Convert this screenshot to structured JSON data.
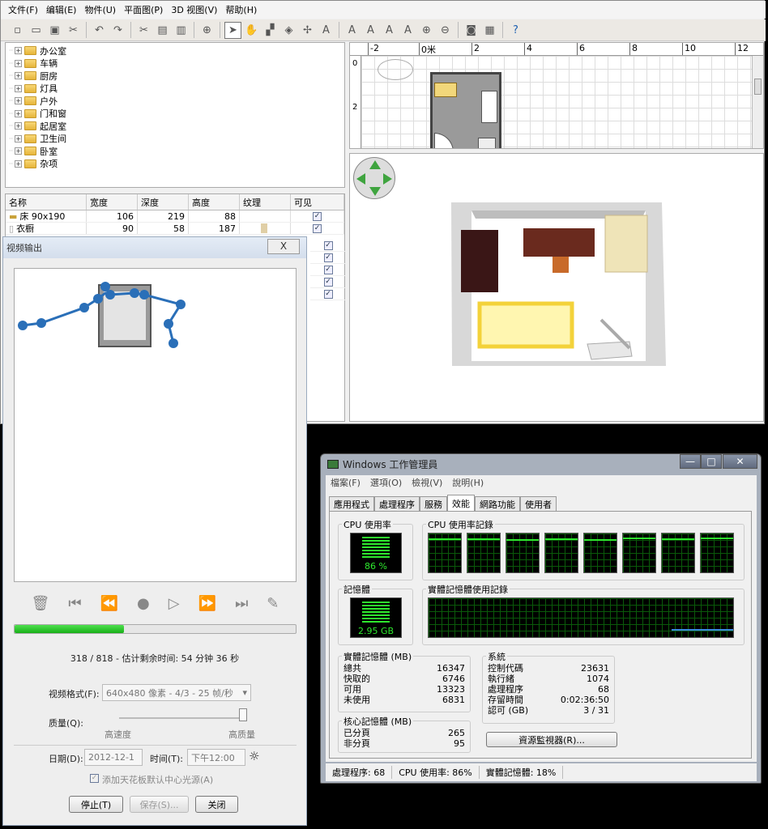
{
  "menubar": {
    "items": [
      "文件(F)",
      "编辑(E)",
      "物件(U)",
      "平面图(P)",
      "3D 视图(V)",
      "帮助(H)"
    ]
  },
  "toolbar": {
    "buttons": [
      "new-icon",
      "open-icon",
      "save-icon",
      "cut-icon",
      "undo-icon",
      "redo-icon",
      "cut2-icon",
      "copy-icon",
      "paste-icon",
      "add-furniture-icon",
      "select-icon",
      "pan-icon",
      "create-walls-icon",
      "create-rooms-icon",
      "create-dimensions-icon",
      "add-text-icon",
      "text-style-icon",
      "bold-icon",
      "italic-icon",
      "zoom-in-icon",
      "zoom-out-icon",
      "photo-icon",
      "video-icon",
      "help-icon"
    ]
  },
  "catalog": {
    "items": [
      "办公室",
      "车辆",
      "厨房",
      "灯具",
      "户外",
      "门和窗",
      "起居室",
      "卫生间",
      "卧室",
      "杂项"
    ]
  },
  "furniture": {
    "headers": [
      "名称",
      "宽度",
      "深度",
      "高度",
      "纹理",
      "可见"
    ],
    "rows": [
      {
        "name": "床 90x190",
        "width": "106",
        "depth": "219",
        "height": "88"
      },
      {
        "name": "衣橱",
        "width": "90",
        "depth": "58",
        "height": "187"
      }
    ]
  },
  "plan": {
    "ruler": [
      "-2",
      "0米",
      "2",
      "4",
      "6",
      "8",
      "10",
      "12"
    ],
    "ruler_left": [
      "0",
      "2"
    ]
  },
  "video": {
    "title": "视频输出",
    "close_label": "X",
    "progress_text": "318 / 818 - 估计剩余时间: 54 分钟 36 秒",
    "progress_fraction": 0.39,
    "format_label": "视频格式(F):",
    "format_value": "640x480 像素 - 4/3 - 25 帧/秒",
    "quality_label": "质量(Q):",
    "quality_low": "高速度",
    "quality_high": "高质量",
    "date_label": "日期(D):",
    "date_value": "2012-12-1",
    "time_label": "时间(T):",
    "time_value": "下午12:00",
    "ceiling_light_label": "添加天花板默认中心光源(A)",
    "stop_button": "停止(T)",
    "save_button": "保存(S)...",
    "close_button": "关闭"
  },
  "taskmgr": {
    "title": "Windows 工作管理員",
    "menu": [
      "檔案(F)",
      "選項(O)",
      "檢視(V)",
      "說明(H)"
    ],
    "tabs": [
      "應用程式",
      "處理程序",
      "服務",
      "效能",
      "網路功能",
      "使用者"
    ],
    "active_tab": "效能",
    "cpu_label": "CPU 使用率",
    "cpu_value": "86 %",
    "cpu_history_label": "CPU 使用率記錄",
    "mem_label": "記憶體",
    "mem_value": "2.95 GB",
    "mem_history_label": "實體記憶體使用記錄",
    "physical_title": "實體記憶體 (MB)",
    "physical": [
      [
        "總共",
        "16347"
      ],
      [
        "快取的",
        "6746"
      ],
      [
        "可用",
        "13323"
      ],
      [
        "未使用",
        "6831"
      ]
    ],
    "kernel_title": "核心記憶體 (MB)",
    "kernel": [
      [
        "已分頁",
        "265"
      ],
      [
        "非分頁",
        "95"
      ]
    ],
    "system_title": "系統",
    "system": [
      [
        "控制代碼",
        "23631"
      ],
      [
        "執行緒",
        "1074"
      ],
      [
        "處理程序",
        "68"
      ],
      [
        "存留時間",
        "0:02:36:50"
      ],
      [
        "認可 (GB)",
        "3 / 31"
      ]
    ],
    "resource_button": "資源監視器(R)...",
    "status": [
      "處理程序: 68",
      "CPU 使用率: 86%",
      "實體記憶體: 18%"
    ]
  }
}
